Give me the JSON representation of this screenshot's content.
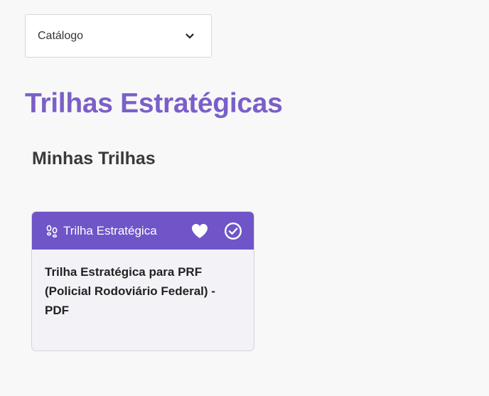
{
  "catalog_select": {
    "value": "Catálogo",
    "icon": "chevron-down-icon"
  },
  "page": {
    "title": "Trilhas Estratégicas",
    "section_title": "Minhas Trilhas"
  },
  "colors": {
    "accent": "#7b5fc8",
    "card_header": "#6f55c7",
    "background": "#f8f8f8"
  },
  "trail_card": {
    "type_label": "Trilha Estratégica",
    "type_icon": "footprints-icon",
    "favorite_icon": "heart-icon",
    "complete_icon": "check-circle-icon",
    "title": "Trilha Estratégica para PRF (Policial Rodoviário Federal) - PDF"
  }
}
